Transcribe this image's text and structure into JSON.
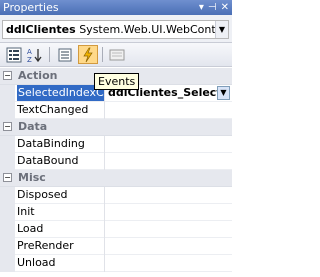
{
  "window": {
    "title": "Properties",
    "controls": [
      "▾",
      "⊣",
      "✕"
    ]
  },
  "object_selector": {
    "name": "ddlClientes",
    "type": "System.Web.UI.WebControls"
  },
  "toolbar": {
    "buttons": [
      "categorized",
      "alphabetical",
      "properties",
      "events",
      "property-pages"
    ],
    "active": "events"
  },
  "tooltip": {
    "text": "Events"
  },
  "grid": {
    "categories": [
      {
        "label": "Action",
        "toggle": "−",
        "items": [
          {
            "name": "SelectedIndexCha",
            "value": "ddlClientes_Select",
            "selected": true
          },
          {
            "name": "TextChanged",
            "value": ""
          }
        ]
      },
      {
        "label": "Data",
        "toggle": "−",
        "items": [
          {
            "name": "DataBinding",
            "value": ""
          },
          {
            "name": "DataBound",
            "value": ""
          }
        ]
      },
      {
        "label": "Misc",
        "toggle": "−",
        "items": [
          {
            "name": "Disposed",
            "value": ""
          },
          {
            "name": "Init",
            "value": ""
          },
          {
            "name": "Load",
            "value": ""
          },
          {
            "name": "PreRender",
            "value": ""
          },
          {
            "name": "Unload",
            "value": ""
          }
        ]
      }
    ]
  }
}
